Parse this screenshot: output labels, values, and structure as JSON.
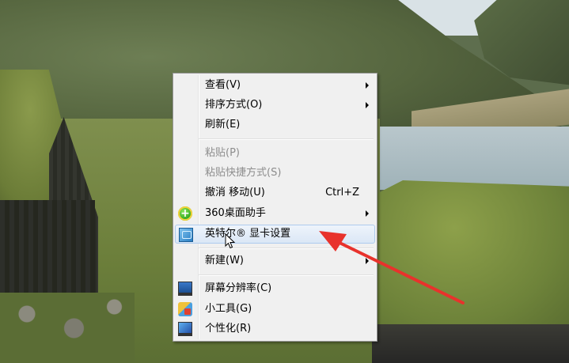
{
  "context_menu": {
    "items": [
      {
        "label": "查看(V)",
        "submenu": true
      },
      {
        "label": "排序方式(O)",
        "submenu": true
      },
      {
        "label": "刷新(E)"
      },
      {
        "label": "粘贴(P)",
        "disabled": true
      },
      {
        "label": "粘贴快捷方式(S)",
        "disabled": true
      },
      {
        "label": "撤消 移动(U)",
        "shortcut": "Ctrl+Z"
      },
      {
        "label": "360桌面助手",
        "submenu": true,
        "icon": "360-assistant-icon"
      },
      {
        "label": "英特尔® 显卡设置",
        "icon": "intel-graphics-icon",
        "highlighted": true
      },
      {
        "label": "新建(W)",
        "submenu": true
      },
      {
        "label": "屏幕分辨率(C)",
        "icon": "screen-resolution-icon"
      },
      {
        "label": "小工具(G)",
        "icon": "gadgets-icon"
      },
      {
        "label": "个性化(R)",
        "icon": "personalize-icon"
      }
    ]
  },
  "colors": {
    "menu_background": "#f0f0f0",
    "highlight": "#dbe7f6",
    "disabled_text": "#8d8d8d",
    "annotation_arrow": "#e8322c"
  }
}
